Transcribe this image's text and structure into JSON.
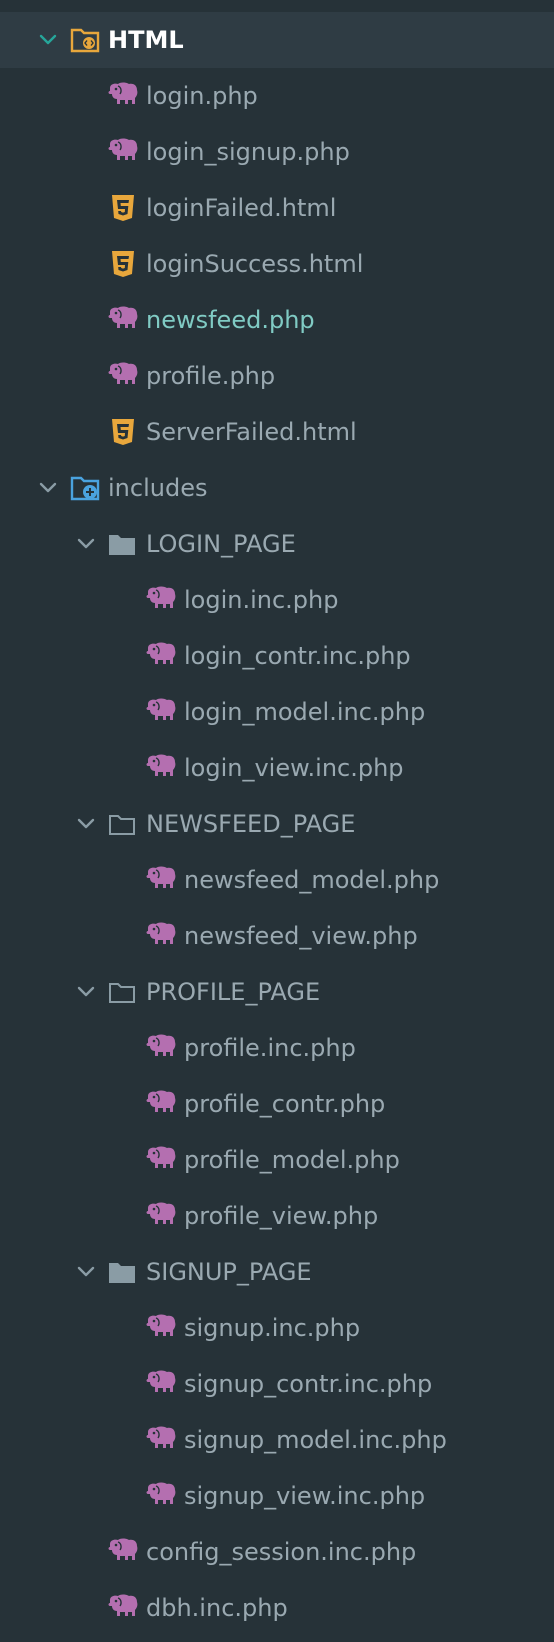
{
  "explorer": {
    "root": {
      "label": "HTML",
      "files": [
        {
          "label": "login.php",
          "icon": "php-icon"
        },
        {
          "label": "login_signup.php",
          "icon": "php-icon"
        },
        {
          "label": "loginFailed.html",
          "icon": "html5-icon"
        },
        {
          "label": "loginSuccess.html",
          "icon": "html5-icon"
        },
        {
          "label": "newsfeed.php",
          "icon": "php-icon",
          "active": true
        },
        {
          "label": "profile.php",
          "icon": "php-icon"
        },
        {
          "label": "ServerFailed.html",
          "icon": "html5-icon"
        }
      ],
      "includes": {
        "label": "includes",
        "folders": [
          {
            "label": "LOGIN_PAGE",
            "files": [
              "login.inc.php",
              "login_contr.inc.php",
              "login_model.inc.php",
              "login_view.inc.php"
            ]
          },
          {
            "label": "NEWSFEED_PAGE",
            "files": [
              "newsfeed_model.php",
              "newsfeed_view.php"
            ]
          },
          {
            "label": "PROFILE_PAGE",
            "files": [
              "profile.inc.php",
              "profile_contr.php",
              "profile_model.php",
              "profile_view.php"
            ]
          },
          {
            "label": "SIGNUP_PAGE",
            "files": [
              "signup.inc.php",
              "signup_contr.inc.php",
              "signup_model.inc.php",
              "signup_view.inc.php"
            ]
          }
        ],
        "files": [
          "config_session.inc.php",
          "dbh.inc.php"
        ]
      }
    }
  },
  "colors": {
    "background": "#263238",
    "selected_row": "#2f3c44",
    "text": "#9aa9b1",
    "active_text": "#80cbc4",
    "php_icon": "#b46fb0",
    "html_icon": "#e8a73c",
    "chevron": "#26a69a",
    "folder_icon": "#8a9ca5"
  }
}
